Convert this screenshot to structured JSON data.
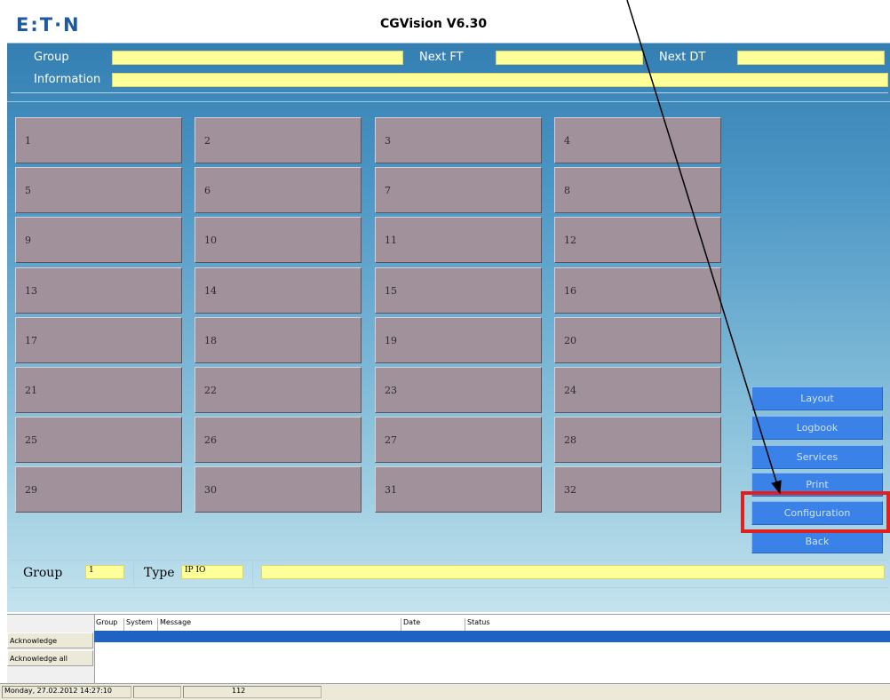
{
  "header": {
    "logo": "E:T·N",
    "title": "CGVision V6.30"
  },
  "info": {
    "group_label": "Group",
    "next_ft_label": "Next FT",
    "next_dt_label": "Next DT",
    "information_label": "Information",
    "group_value": "",
    "next_ft_value": "",
    "next_dt_value": "",
    "information_value": ""
  },
  "grid": {
    "buttons": [
      "1",
      "2",
      "3",
      "4",
      "5",
      "6",
      "7",
      "8",
      "9",
      "10",
      "11",
      "12",
      "13",
      "14",
      "15",
      "16",
      "17",
      "18",
      "19",
      "20",
      "21",
      "22",
      "23",
      "24",
      "25",
      "26",
      "27",
      "28",
      "29",
      "30",
      "31",
      "32"
    ]
  },
  "side_menu": {
    "items": [
      "Layout",
      "Logbook",
      "Services",
      "Print",
      "Configuration",
      "Back"
    ],
    "highlighted": "Configuration"
  },
  "bottom": {
    "group_label": "Group",
    "group_value": "1",
    "type_label": "Type",
    "type_value": "IP IO",
    "info_value": ""
  },
  "log": {
    "buttons": [
      "Acknowledge",
      "Acknowledge all"
    ],
    "columns": [
      "Group",
      "System",
      "Message",
      "Date",
      "Status"
    ]
  },
  "status": {
    "datetime": "Monday, 27.02.2012 14:27:10",
    "cell2": "",
    "count": "112"
  },
  "colors": {
    "highlight": "#e0201f",
    "button_gray": "#a1919a",
    "menu_blue": "#3a82e8",
    "field_yellow": "#ffff99"
  }
}
